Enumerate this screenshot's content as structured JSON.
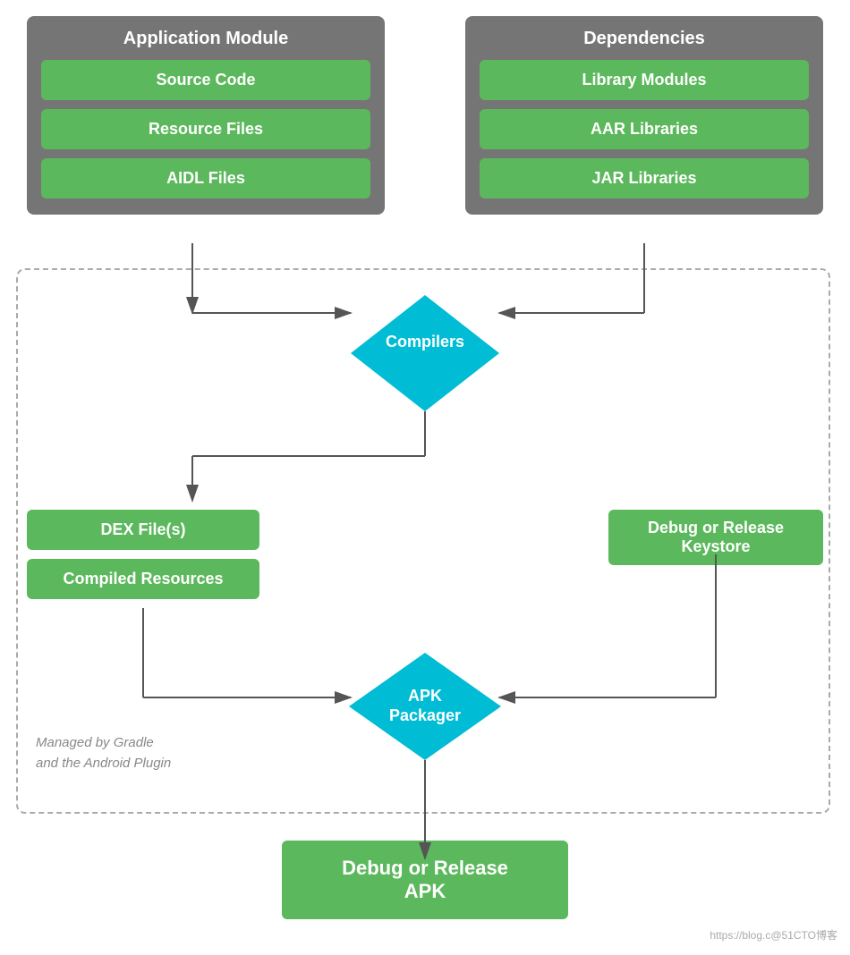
{
  "app_module": {
    "title": "Application Module",
    "items": [
      "Source Code",
      "Resource Files",
      "AIDL Files"
    ]
  },
  "dependencies": {
    "title": "Dependencies",
    "items": [
      "Library Modules",
      "AAR Libraries",
      "JAR Libraries"
    ]
  },
  "compilers_label": "Compilers",
  "dex_label": "DEX File(s)",
  "compiled_resources_label": "Compiled Resources",
  "keystore_label": "Debug or Release\nKeystore",
  "apk_packager_label": "APK\nPackager",
  "final_apk_label": "Debug or Release\nAPK",
  "gradle_note_line1": "Managed by Gradle",
  "gradle_note_line2": "and the Android Plugin",
  "watermark": "https://blog.c@51CTO博客",
  "colors": {
    "green": "#5cb85c",
    "gray": "#757575",
    "cyan": "#00bcd4",
    "white": "#ffffff",
    "arrow": "#555555"
  }
}
